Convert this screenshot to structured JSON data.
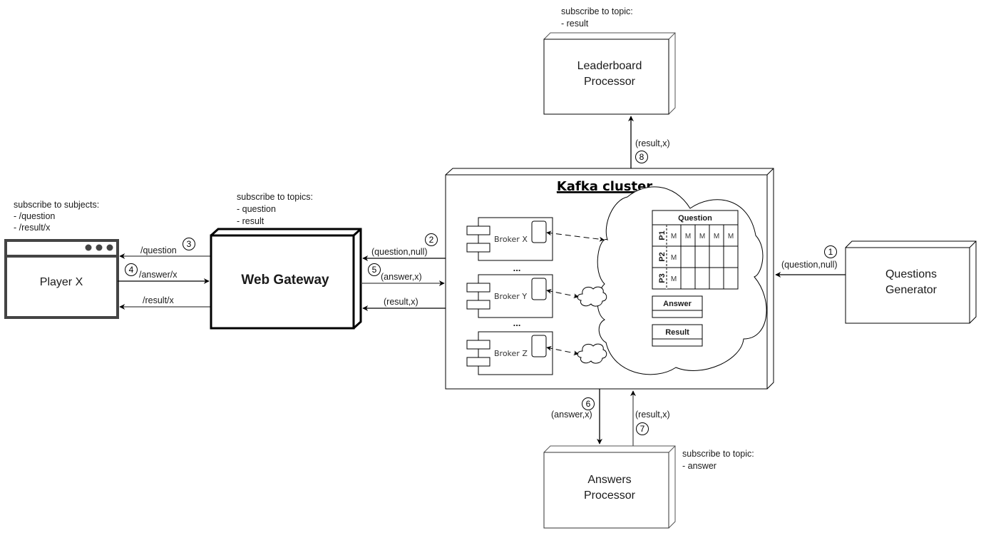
{
  "player": {
    "title": "Player X",
    "note": [
      "subscribe to subjects:",
      "- /question",
      "- /result/x"
    ]
  },
  "gateway": {
    "title": "Web Gateway",
    "note": [
      "subscribe to topics:",
      "- question",
      "- result"
    ]
  },
  "kafka": {
    "title": "Kafka cluster",
    "brokers": [
      "Broker X",
      "Broker Y",
      "Broker Z"
    ],
    "ellipsis": "...",
    "topics": {
      "question": {
        "name": "Question",
        "partitions": [
          {
            "label": "P1",
            "messages": [
              "M",
              "M",
              "M",
              "M",
              "M"
            ]
          },
          {
            "label": "P2",
            "messages": [
              "M",
              "",
              "",
              "",
              ""
            ]
          },
          {
            "label": "P3",
            "messages": [
              "M",
              "",
              "",
              "",
              ""
            ]
          }
        ]
      },
      "answer": {
        "name": "Answer"
      },
      "result": {
        "name": "Result"
      }
    }
  },
  "leaderboard": {
    "title": [
      "Leaderboard",
      "Processor"
    ],
    "note": [
      "subscribe to topic:",
      "- result"
    ]
  },
  "answers_processor": {
    "title": [
      "Answers",
      "Processor"
    ],
    "note": [
      "subscribe to topic:",
      "- answer"
    ]
  },
  "questions_generator": {
    "title": [
      "Questions",
      "Generator"
    ]
  },
  "flows": [
    {
      "step": "1",
      "label": "(question,null)"
    },
    {
      "step": "2",
      "label": "(question,null)"
    },
    {
      "step": "3",
      "label": "/question"
    },
    {
      "step": "4",
      "label": "/answer/x"
    },
    {
      "step": "5",
      "label": "(answer,x)"
    },
    {
      "step": "6",
      "label": "(answer,x)"
    },
    {
      "step": "7",
      "label": "(result,x)"
    },
    {
      "step": "8",
      "label": "(result,x)"
    }
  ],
  "unnumbered_flows": {
    "player_result": "/result/x",
    "gateway_result": "(result,x)"
  }
}
